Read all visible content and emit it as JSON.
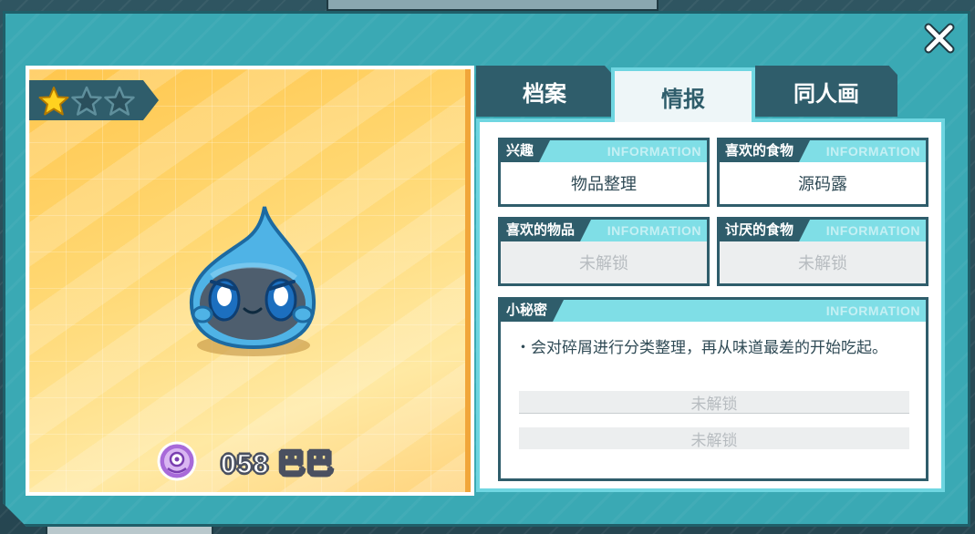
{
  "colors": {
    "panel": "#3aa9b4",
    "dark_teal": "#2f5d6b",
    "light_cyan": "#7fdee6",
    "card_orange": "#ffc64d",
    "star_gold": "#ffd21f"
  },
  "icons": {
    "close": "close-icon",
    "star_filled": "star-filled-icon",
    "star_empty": "star-empty-icon",
    "element": "element-badge-icon"
  },
  "character": {
    "name": "058 巴巴",
    "stars_filled": 1,
    "stars_total": 3
  },
  "tabs": [
    {
      "label": "档案",
      "active": false
    },
    {
      "label": "情报",
      "active": true
    },
    {
      "label": "同人画",
      "active": false
    }
  ],
  "info": {
    "watermark": "INFORMATION",
    "hobby": {
      "label": "兴趣",
      "value": "物品整理"
    },
    "liked_food": {
      "label": "喜欢的食物",
      "value": "源码露"
    },
    "liked_item": {
      "label": "喜欢的物品",
      "value": "未解锁"
    },
    "hated_food": {
      "label": "讨厌的食物",
      "value": "未解锁"
    },
    "secret": {
      "label": "小秘密",
      "text": "・会对碎屑进行分类整理，再从味道最差的开始吃起。",
      "locked_1": "未解锁",
      "locked_2": "未解锁"
    }
  }
}
